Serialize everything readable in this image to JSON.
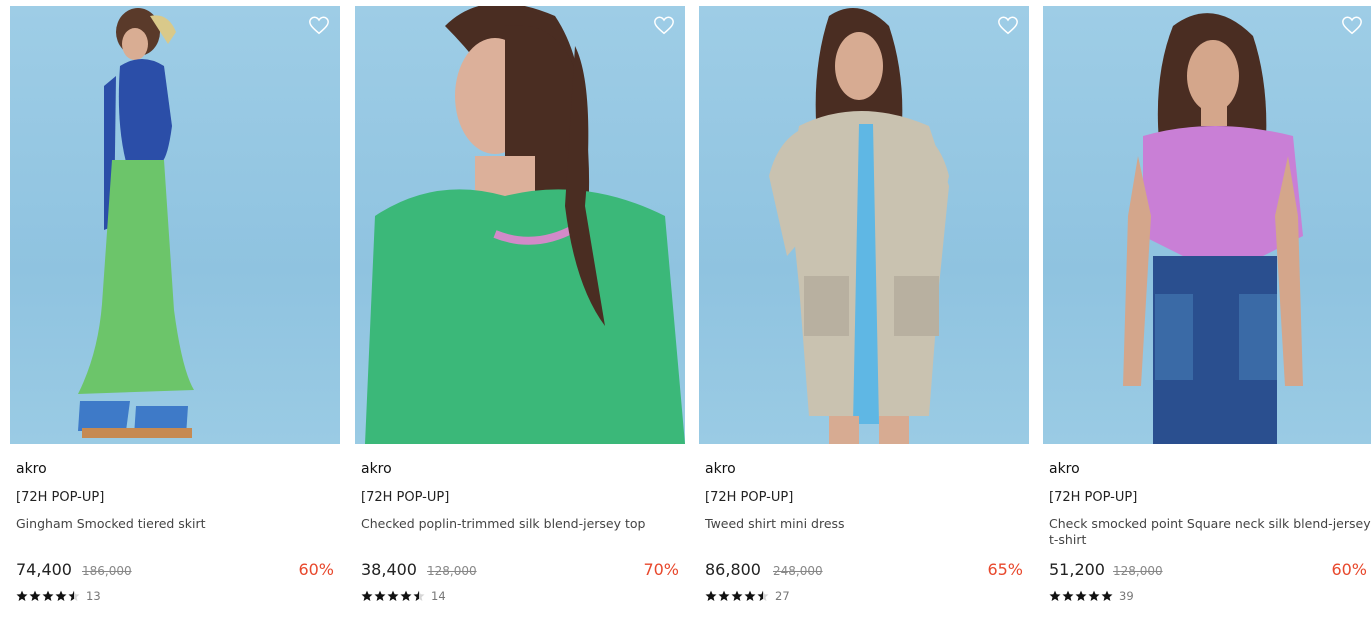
{
  "products": [
    {
      "brand": "akro",
      "tag": "[72H POP-UP]",
      "name": "Gingham Smocked tiered skirt",
      "price": "74,400",
      "original_price": "186,000",
      "discount": "60%",
      "rating": 4.5,
      "review_count": "13",
      "colors": {
        "top": "#2b4ea8",
        "bottom": "#6cc56a"
      }
    },
    {
      "brand": "akro",
      "tag": "[72H POP-UP]",
      "name": "Checked poplin-trimmed silk blend-jersey top",
      "price": "38,400",
      "original_price": "128,000",
      "discount": "70%",
      "rating": 4.5,
      "review_count": "14",
      "colors": {
        "top": "#3bb879",
        "bottom": "#3bb879"
      }
    },
    {
      "brand": "akro",
      "tag": "[72H POP-UP]",
      "name": "Tweed shirt mini dress",
      "price": "86,800",
      "original_price": "248,000",
      "discount": "65%",
      "rating": 4.5,
      "review_count": "27",
      "colors": {
        "top": "#c9c2b0",
        "bottom": "#c9c2b0"
      }
    },
    {
      "brand": "akro",
      "tag": "[72H POP-UP]",
      "name": "Check smocked point Square neck silk blend-jersey t-shirt",
      "price": "51,200",
      "original_price": "128,000",
      "discount": "60%",
      "rating": 5,
      "review_count": "39",
      "colors": {
        "top": "#c97fd6",
        "bottom": "#2a4f8f"
      }
    }
  ]
}
